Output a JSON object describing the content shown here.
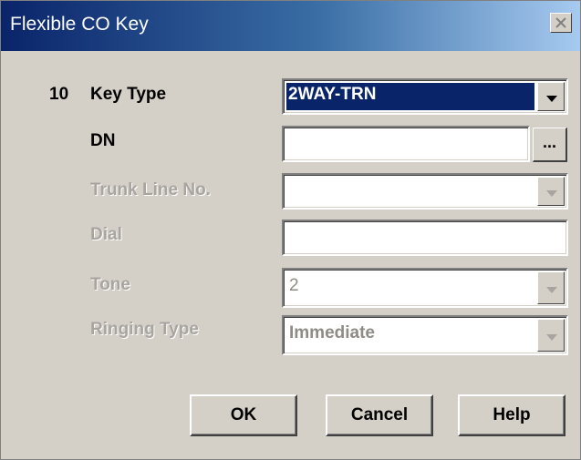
{
  "window": {
    "title": "Flexible CO Key"
  },
  "form": {
    "index": "10",
    "key_type": {
      "label": "Key Type",
      "value": "2WAY-TRN"
    },
    "dn": {
      "label": "DN",
      "value": "",
      "browse_label": "..."
    },
    "trunk_line": {
      "label": "Trunk Line No.",
      "value": ""
    },
    "dial": {
      "label": "Dial",
      "value": ""
    },
    "tone": {
      "label": "Tone",
      "value": "2"
    },
    "ringing_type": {
      "label": "Ringing Type",
      "value": "Immediate"
    }
  },
  "buttons": {
    "ok": "OK",
    "cancel": "Cancel",
    "help": "Help"
  },
  "icons": {
    "close": "close-icon",
    "dropdown": "chevron-down-icon"
  },
  "colors": {
    "title_start": "#0a246a",
    "title_end": "#a6caf0",
    "face": "#d4d0c8",
    "selection": "#0a246a"
  }
}
